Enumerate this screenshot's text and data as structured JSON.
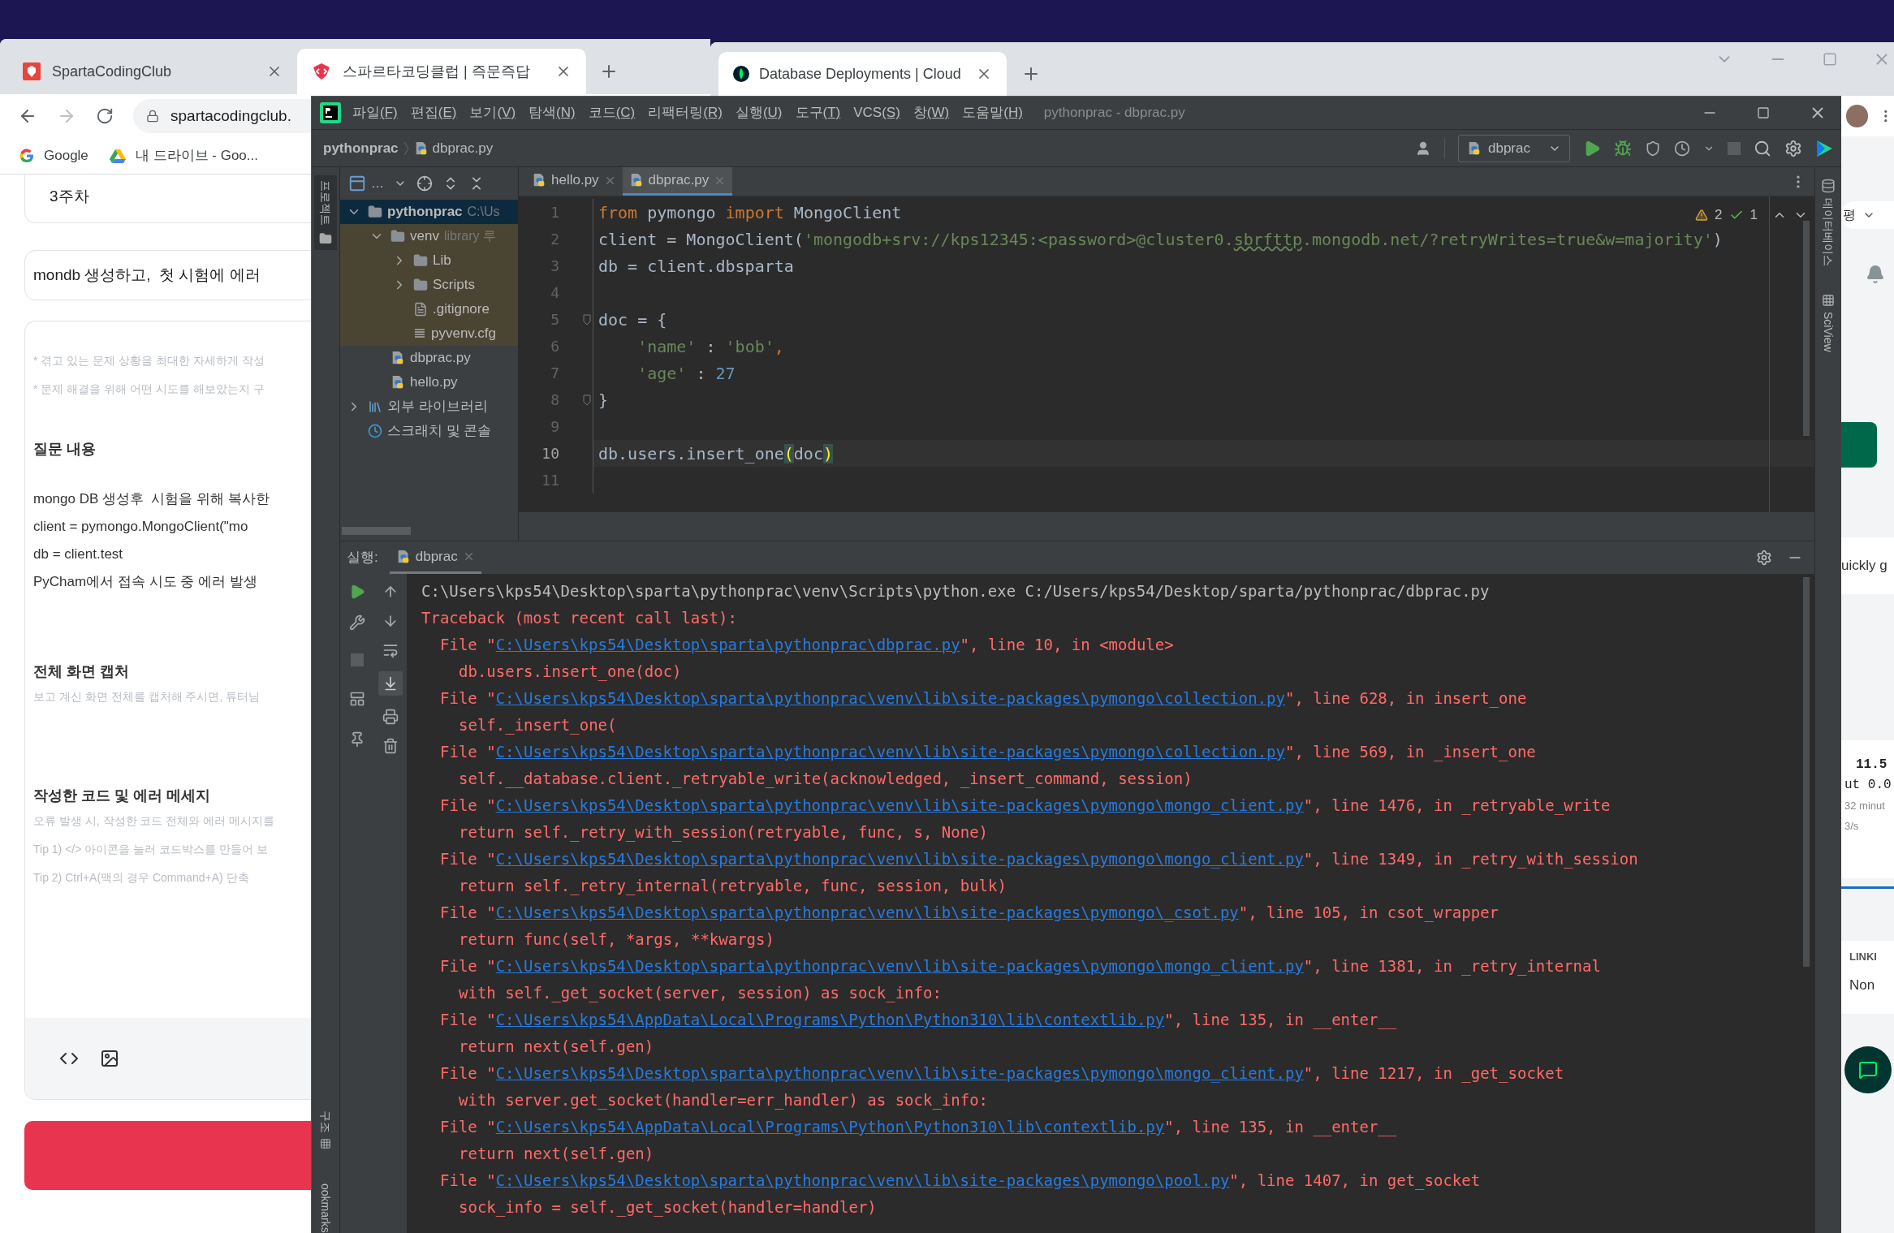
{
  "left_browser": {
    "tabs": [
      {
        "label": "SpartaCodingClub",
        "selected": false,
        "kind": "brand"
      },
      {
        "label": "스파르타코딩클럽 | 즉문즉답",
        "selected": true,
        "kind": "chat"
      }
    ],
    "url": "spartacodingclub.",
    "bookmarks": [
      {
        "label": "Google",
        "kind": "google"
      },
      {
        "label": "내 드라이브 - Goo...",
        "kind": "drive"
      }
    ],
    "page": {
      "week": "3주차",
      "title_value": "mondb 생성하고,  첫 시험에 에러",
      "blocks": [
        {
          "kind": "hint",
          "text": "* 겪고 있는 문제 상황을 최대한 자세하게 작성"
        },
        {
          "kind": "hint",
          "text": "* 문제 해결을 위해 어떤 시도를 해보았는지 구"
        },
        {
          "kind": "heading",
          "text": "질문 내용"
        },
        {
          "kind": "body",
          "text": "mongo DB 생성후  시험을 위해 복사한"
        },
        {
          "kind": "body",
          "text": "client = pymongo.MongoClient(\"mo"
        },
        {
          "kind": "body",
          "text": "db = client.test"
        },
        {
          "kind": "body",
          "text": "PyCham에서 접속 시도 중 에러 발생"
        },
        {
          "kind": "heading",
          "text": "전체 화면 캡처"
        },
        {
          "kind": "hint",
          "text": "보고 계신 화면 전체를 캡처해 주시면, 튜터님"
        },
        {
          "kind": "heading",
          "text": "작성한 코드 및 에러 메세지"
        },
        {
          "kind": "hint",
          "text": "오류 발생 시, 작성한 코드 전체와 에러 메시지를"
        },
        {
          "kind": "hint",
          "text": "Tip 1) </> 아이콘을 눌러 코드박스를 만들어 보"
        },
        {
          "kind": "hint",
          "text": "Tip 2) Ctrl+A(맥의 경우 Command+A) 단축"
        }
      ]
    }
  },
  "right_browser": {
    "tabs": [
      {
        "label": "Database Deployments | Cloud",
        "selected": true
      }
    ],
    "sort_label": "평",
    "prompt_fragment": "uickly g",
    "stats": [
      "11.5",
      "ut 0.0",
      "32 minut",
      "3/s"
    ],
    "links_label": "LINKI",
    "links_value": "Non"
  },
  "ide": {
    "title": "pythonprac - dbprac.py",
    "menus": [
      {
        "label": "파일",
        "key": "(F)"
      },
      {
        "label": "편집",
        "key": "(E)"
      },
      {
        "label": "보기",
        "key": "(V)"
      },
      {
        "label": "탐색",
        "key": "(N)"
      },
      {
        "label": "코드",
        "key": "(C)"
      },
      {
        "label": "리팩터링",
        "key": "(R)"
      },
      {
        "label": "실행",
        "key": "(U)"
      },
      {
        "label": "도구",
        "key": "(T)"
      },
      {
        "label": "VCS",
        "key": "(S)"
      },
      {
        "label": "창",
        "key": "(W)"
      },
      {
        "label": "도움말",
        "key": "(H)"
      }
    ],
    "breadcrumb": [
      "pythonprac",
      "dbprac.py"
    ],
    "run_config": "dbprac",
    "left_strip": {
      "top": "프로젝트",
      "bottom": [
        "구조",
        "ookmarks"
      ]
    },
    "right_strip": [
      "데이터베이스",
      "SciView"
    ],
    "tree": [
      {
        "label": "pythonprac",
        "hint": "C:\\Us",
        "kind": "folder",
        "expanded": true,
        "selected": true,
        "excluded": false,
        "children": [
          {
            "label": "venv",
            "hint": "library 루",
            "kind": "folder",
            "expanded": true,
            "selected": false,
            "excluded": true,
            "children": [
              {
                "label": "Lib",
                "kind": "folder",
                "expanded": false,
                "selected": false,
                "excluded": true
              },
              {
                "label": "Scripts",
                "kind": "folder",
                "expanded": false,
                "selected": false,
                "excluded": true
              },
              {
                "label": ".gitignore",
                "kind": "ignore-file",
                "selected": false,
                "excluded": true
              },
              {
                "label": "pyvenv.cfg",
                "kind": "config-file",
                "selected": false,
                "excluded": true
              }
            ]
          },
          {
            "label": "dbprac.py",
            "kind": "python-file",
            "selected": false,
            "excluded": false
          },
          {
            "label": "hello.py",
            "kind": "python-file",
            "selected": false,
            "excluded": false
          }
        ]
      },
      {
        "label": "외부 라이브러리",
        "kind": "libraries",
        "expanded": false,
        "selected": false,
        "excluded": false
      },
      {
        "label": "스크래치 및 콘솔",
        "kind": "scratches",
        "selected": false,
        "excluded": false
      }
    ],
    "editor_tabs": [
      {
        "label": "hello.py",
        "selected": false
      },
      {
        "label": "dbprac.py",
        "selected": true
      }
    ],
    "inspections": {
      "warnings": "2",
      "ok": "1"
    },
    "project_toolbar_dots": "…",
    "code": [
      {
        "n": "1",
        "current": false,
        "fold": false,
        "tokens": [
          {
            "text": "from",
            "kind": "kw"
          },
          {
            "text": " pymongo ",
            "kind": "plain"
          },
          {
            "text": "import",
            "kind": "kw"
          },
          {
            "text": " MongoClient",
            "kind": "plain"
          }
        ]
      },
      {
        "n": "2",
        "current": false,
        "fold": false,
        "tokens": [
          {
            "text": "client = MongoClient(",
            "kind": "plain"
          },
          {
            "text": "'mongodb+srv://kps12345:<password>@cluster0.",
            "kind": "str"
          },
          {
            "text": "sbrfttp",
            "kind": "typo"
          },
          {
            "text": ".mongodb.net/?retryWrites=true&w=majority'",
            "kind": "str"
          },
          {
            "text": ")",
            "kind": "plain"
          }
        ]
      },
      {
        "n": "3",
        "current": false,
        "fold": false,
        "tokens": [
          {
            "text": "db = client.dbsparta",
            "kind": "plain"
          }
        ]
      },
      {
        "n": "4",
        "current": false,
        "fold": false
      },
      {
        "n": "5",
        "current": false,
        "fold": true,
        "tokens": [
          {
            "text": "doc = {",
            "kind": "plain"
          }
        ]
      },
      {
        "n": "6",
        "current": false,
        "fold": false,
        "tokens": [
          {
            "text": "    'name'",
            "kind": "str"
          },
          {
            "text": " : ",
            "kind": "plain"
          },
          {
            "text": "'bob'",
            "kind": "str"
          },
          {
            "text": ",",
            "kind": "kw"
          }
        ]
      },
      {
        "n": "7",
        "current": false,
        "fold": false,
        "tokens": [
          {
            "text": "    'age'",
            "kind": "str"
          },
          {
            "text": " : ",
            "kind": "plain"
          },
          {
            "text": "27",
            "kind": "num"
          }
        ]
      },
      {
        "n": "8",
        "current": false,
        "fold": true,
        "tokens": [
          {
            "text": "}",
            "kind": "plain"
          }
        ]
      },
      {
        "n": "9",
        "current": false,
        "fold": false
      },
      {
        "n": "10",
        "current": true,
        "fold": false,
        "tokens": [
          {
            "text": "db.users.insert_one",
            "kind": "plain"
          },
          {
            "text": "(",
            "kind": "brace"
          },
          {
            "text": "doc",
            "kind": "plain"
          },
          {
            "text": ")",
            "kind": "brace"
          }
        ]
      },
      {
        "n": "11",
        "current": false,
        "fold": false
      }
    ],
    "run": {
      "label": "실행:",
      "tab": "dbprac",
      "output": [
        {
          "kind": "command",
          "text": "C:\\Users\\kps54\\Desktop\\sparta\\pythonprac\\venv\\Scripts\\python.exe C:/Users/kps54/Desktop/sparta/pythonprac/dbprac.py"
        },
        {
          "kind": "error",
          "text": "Traceback (most recent call last):"
        },
        {
          "kind": "file",
          "prefix": "File \"",
          "link": "C:\\Users\\kps54\\Desktop\\sparta\\pythonprac\\dbprac.py",
          "suffix": "\", line 10, in <module>"
        },
        {
          "kind": "code",
          "text": "db.users.insert_one(doc)"
        },
        {
          "kind": "file",
          "prefix": "File \"",
          "link": "C:\\Users\\kps54\\Desktop\\sparta\\pythonprac\\venv\\lib\\site-packages\\pymongo\\collection.py",
          "suffix": "\", line 628, in insert_one"
        },
        {
          "kind": "code",
          "text": "self._insert_one("
        },
        {
          "kind": "file",
          "prefix": "File \"",
          "link": "C:\\Users\\kps54\\Desktop\\sparta\\pythonprac\\venv\\lib\\site-packages\\pymongo\\collection.py",
          "suffix": "\", line 569, in _insert_one"
        },
        {
          "kind": "code",
          "text": "self.__database.client._retryable_write(acknowledged, _insert_command, session)"
        },
        {
          "kind": "file",
          "prefix": "File \"",
          "link": "C:\\Users\\kps54\\Desktop\\sparta\\pythonprac\\venv\\lib\\site-packages\\pymongo\\mongo_client.py",
          "suffix": "\", line 1476, in _retryable_write"
        },
        {
          "kind": "code",
          "text": "return self._retry_with_session(retryable, func, s, None)"
        },
        {
          "kind": "file",
          "prefix": "File \"",
          "link": "C:\\Users\\kps54\\Desktop\\sparta\\pythonprac\\venv\\lib\\site-packages\\pymongo\\mongo_client.py",
          "suffix": "\", line 1349, in _retry_with_session"
        },
        {
          "kind": "code",
          "text": "return self._retry_internal(retryable, func, session, bulk)"
        },
        {
          "kind": "file",
          "prefix": "File \"",
          "link": "C:\\Users\\kps54\\Desktop\\sparta\\pythonprac\\venv\\lib\\site-packages\\pymongo\\_csot.py",
          "suffix": "\", line 105, in csot_wrapper"
        },
        {
          "kind": "code",
          "text": "return func(self, *args, **kwargs)"
        },
        {
          "kind": "file",
          "prefix": "File \"",
          "link": "C:\\Users\\kps54\\Desktop\\sparta\\pythonprac\\venv\\lib\\site-packages\\pymongo\\mongo_client.py",
          "suffix": "\", line 1381, in _retry_internal"
        },
        {
          "kind": "code",
          "text": "with self._get_socket(server, session) as sock_info:"
        },
        {
          "kind": "file",
          "prefix": "File \"",
          "link": "C:\\Users\\kps54\\AppData\\Local\\Programs\\Python\\Python310\\lib\\contextlib.py",
          "suffix": "\", line 135, in __enter__"
        },
        {
          "kind": "code",
          "text": "return next(self.gen)"
        },
        {
          "kind": "file",
          "prefix": "File \"",
          "link": "C:\\Users\\kps54\\Desktop\\sparta\\pythonprac\\venv\\lib\\site-packages\\pymongo\\mongo_client.py",
          "suffix": "\", line 1217, in _get_socket"
        },
        {
          "kind": "code",
          "text": "with server.get_socket(handler=err_handler) as sock_info:"
        },
        {
          "kind": "file",
          "prefix": "File \"",
          "link": "C:\\Users\\kps54\\AppData\\Local\\Programs\\Python\\Python310\\lib\\contextlib.py",
          "suffix": "\", line 135, in __enter__"
        },
        {
          "kind": "code",
          "text": "return next(self.gen)"
        },
        {
          "kind": "file",
          "prefix": "File \"",
          "link": "C:\\Users\\kps54\\Desktop\\sparta\\pythonprac\\venv\\lib\\site-packages\\pymongo\\pool.py",
          "suffix": "\", line 1407, in get_socket"
        },
        {
          "kind": "code",
          "text": "sock_info = self._get_socket(handler=handler)"
        }
      ]
    }
  }
}
